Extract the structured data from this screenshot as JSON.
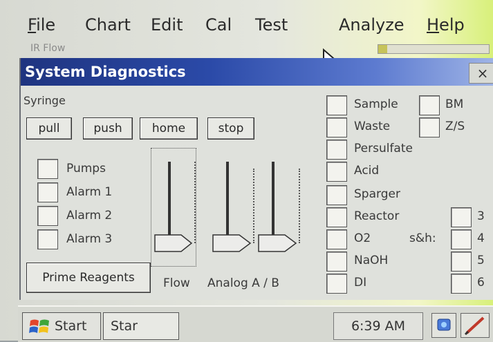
{
  "menubar": {
    "items": [
      {
        "label": "File",
        "accel": "F",
        "rest": "ile"
      },
      {
        "label": "Chart"
      },
      {
        "label": "Edit"
      },
      {
        "label": "Cal"
      },
      {
        "label": "Test"
      },
      {
        "label": "Analyze"
      },
      {
        "label": "Help",
        "accel": "H",
        "rest": "elp"
      }
    ]
  },
  "background_strip": {
    "text": "IR  Flow"
  },
  "dialog": {
    "title": "System Diagnostics",
    "close_label": "×",
    "syringe_label": "Syringe",
    "syringe_buttons": [
      "pull",
      "push",
      "home",
      "stop"
    ],
    "status_checks": [
      "Pumps",
      "Alarm 1",
      "Alarm 2",
      "Alarm 3"
    ],
    "prime_button": "Prime Reagents",
    "flow_label": "Flow",
    "analog_label": "Analog A / B",
    "valves": [
      "Sample",
      "Waste",
      "Persulfate",
      "Acid",
      "Sparger",
      "Reactor",
      "O2",
      "NaOH",
      "DI"
    ],
    "extra_checks": [
      "BM",
      "Z/S"
    ],
    "sh_label": "s&h:",
    "sh_checks": [
      "3",
      "4",
      "5",
      "6"
    ]
  },
  "taskbar": {
    "start_label": "Start",
    "task_label": "Star",
    "clock": "6:39 AM"
  },
  "icons": {
    "cursor": "mouse-pointer-icon",
    "windows": "windows-flag-icon",
    "network": "network-tray-icon",
    "pen": "pen-tray-icon"
  }
}
